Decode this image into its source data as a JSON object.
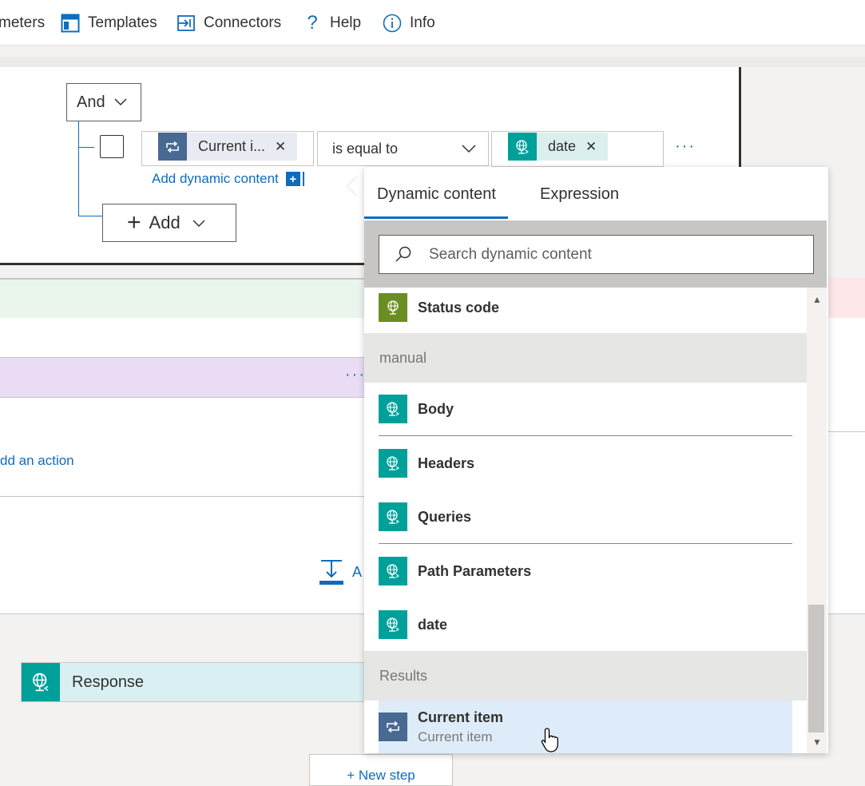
{
  "toolbar": {
    "items": [
      {
        "label": "meters",
        "icon": "parameters-icon"
      },
      {
        "label": "Templates",
        "icon": "templates-icon"
      },
      {
        "label": "Connectors",
        "icon": "connectors-icon"
      },
      {
        "label": "Help",
        "icon": "help-icon"
      },
      {
        "label": "Info",
        "icon": "info-icon"
      }
    ]
  },
  "condition": {
    "group_operator": "And",
    "left_token": "Current i...",
    "operator": "is equal to",
    "right_token": "date",
    "add_dynamic_content": "Add dynamic content",
    "add_label": "Add"
  },
  "canvas": {
    "add_action": "dd an action",
    "insert_label": "A",
    "response_title": "Response",
    "new_step": "+ New step"
  },
  "popup": {
    "tabs": [
      "Dynamic content",
      "Expression"
    ],
    "active_tab": "Dynamic content",
    "search_placeholder": "Search dynamic content",
    "items": {
      "status_code": "Status code",
      "group_manual": "manual",
      "body": "Body",
      "headers": "Headers",
      "queries": "Queries",
      "path_parameters": "Path Parameters",
      "date": "date",
      "group_results": "Results",
      "current_item": "Current item",
      "current_item_sub": "Current item"
    }
  },
  "colors": {
    "accent": "#0f6cbd",
    "teal": "#00a09a",
    "olive": "#6b8e23",
    "loop_blue": "#486991"
  }
}
